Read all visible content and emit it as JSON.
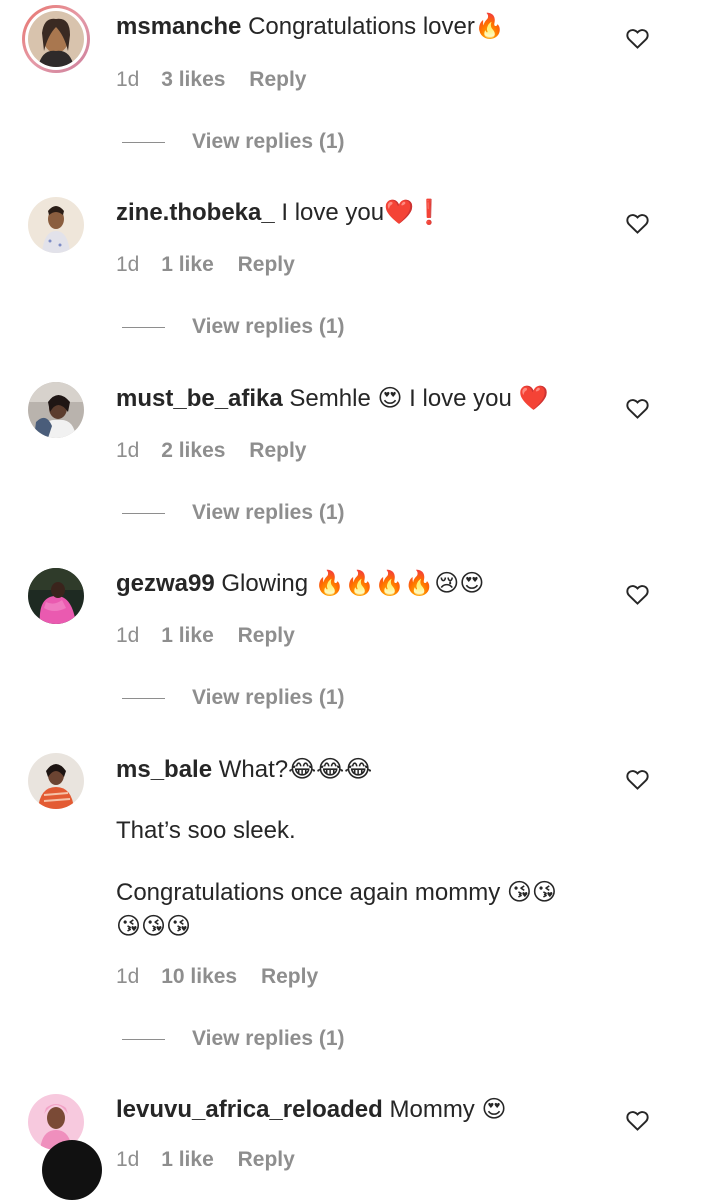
{
  "comments": [
    {
      "username": "msmanche",
      "text": "Congratulations lover🔥",
      "extra_lines": [],
      "time": "1d",
      "likes": "3 likes",
      "reply": "Reply",
      "view_replies": "View replies (1)",
      "avatar_color": "#c9a07e",
      "has_story_ring": true
    },
    {
      "username": "zine.thobeka_",
      "text": "I love you❤️❗",
      "extra_lines": [],
      "time": "1d",
      "likes": "1 like",
      "reply": "Reply",
      "view_replies": "View replies (1)",
      "avatar_color": "#e8d8c8"
    },
    {
      "username": "must_be_afika",
      "text": "Semhle 😍 I love you ❤️",
      "extra_lines": [],
      "time": "1d",
      "likes": "2 likes",
      "reply": "Reply",
      "view_replies": "View replies (1)",
      "avatar_color": "#6f5a52"
    },
    {
      "username": "gezwa99",
      "text": "Glowing 🔥🔥🔥🔥😢😍",
      "extra_lines": [],
      "time": "1d",
      "likes": "1 like",
      "reply": "Reply",
      "view_replies": "View replies (1)",
      "avatar_color": "#e05aa8"
    },
    {
      "username": "ms_bale",
      "text": "What?😂😂😂",
      "extra_lines": [
        "That’s soo sleek.",
        "",
        "Congratulations once again mommy 😘😘",
        "😘😘😘"
      ],
      "time": "1d",
      "likes": "10 likes",
      "reply": "Reply",
      "view_replies": "View replies (1)",
      "avatar_color": "#d9583a"
    },
    {
      "username": "levuvu_africa_reloaded",
      "text": "Mommy 😍",
      "extra_lines": [],
      "time": "1d",
      "likes": "1 like",
      "reply": "Reply",
      "avatar_color": "#f4a6c8"
    }
  ],
  "colors": {
    "text": "#262626",
    "muted": "#8e8e8e",
    "story_ring": "#e8736b"
  },
  "icons": {
    "like": "heart-outline-icon"
  }
}
